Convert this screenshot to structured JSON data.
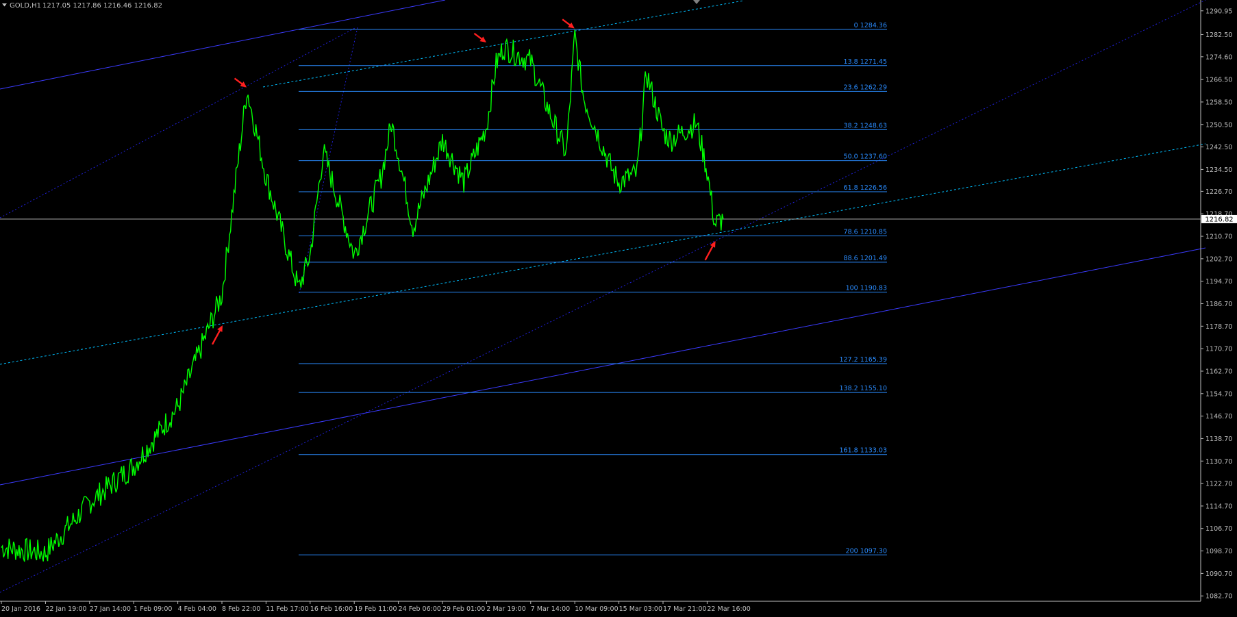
{
  "header": {
    "symbol": "GOLD,H1",
    "ohlc": "1217.05 1217.86 1216.46 1216.82",
    "menu_icon": "triangle-down-icon"
  },
  "colors": {
    "background": "#000000",
    "price": "#00ff00",
    "fib": "#2a8cff",
    "channel": "#3b3bff",
    "dashed": "#00bfff",
    "arrow": "#ff1f1f",
    "axis": "#c0c0c0"
  },
  "chart_data": {
    "type": "line",
    "title": "",
    "xlabel": "",
    "ylabel": "",
    "ylim": [
      1080.8,
      1294.8
    ],
    "grid": false,
    "current_price": "1216.82",
    "y_ticks": [
      "1290.95",
      "1282.50",
      "1274.60",
      "1266.50",
      "1258.50",
      "1250.50",
      "1242.50",
      "1234.50",
      "1226.70",
      "1218.70",
      "1210.70",
      "1202.70",
      "1194.70",
      "1186.70",
      "1178.70",
      "1170.70",
      "1162.70",
      "1154.70",
      "1146.70",
      "1138.70",
      "1130.70",
      "1122.70",
      "1114.70",
      "1106.70",
      "1098.70",
      "1090.70",
      "1082.70"
    ],
    "x_ticks": [
      "20 Jan 2016",
      "22 Jan 19:00",
      "27 Jan 14:00",
      "1 Feb 09:00",
      "4 Feb 04:00",
      "8 Feb 22:00",
      "11 Feb 17:00",
      "16 Feb 16:00",
      "19 Feb 11:00",
      "24 Feb 06:00",
      "29 Feb 01:00",
      "2 Mar 19:00",
      "7 Mar 14:00",
      "10 Mar 09:00",
      "15 Mar 03:00",
      "17 Mar 21:00",
      "22 Mar 16:00"
    ],
    "fib_levels": [
      {
        "label": "0 1284.36",
        "price": 1284.36
      },
      {
        "label": "13.8 1271.45",
        "price": 1271.45
      },
      {
        "label": "23.6 1262.29",
        "price": 1262.29
      },
      {
        "label": "38.2 1248.63",
        "price": 1248.63
      },
      {
        "label": "50.0 1237.60",
        "price": 1237.6
      },
      {
        "label": "61.8 1226.56",
        "price": 1226.56
      },
      {
        "label": "78.6 1210.85",
        "price": 1210.85
      },
      {
        "label": "88.6 1201.49",
        "price": 1201.49
      },
      {
        "label": "100 1190.83",
        "price": 1190.83
      },
      {
        "label": "127.2 1165.39",
        "price": 1165.39
      },
      {
        "label": "138.2 1155.10",
        "price": 1155.1
      },
      {
        "label": "161.8 1133.03",
        "price": 1133.03
      },
      {
        "label": "200 1097.30",
        "price": 1097.3
      }
    ],
    "price_series": [
      {
        "x": "20 Jan 2016",
        "y": 1100
      },
      {
        "x": "22 Jan 19:00",
        "y": 1098
      },
      {
        "x": "27 Jan 14:00",
        "y": 1116
      },
      {
        "x": "1 Feb 09:00",
        "y": 1129
      },
      {
        "x": "4 Feb 04:00",
        "y": 1150
      },
      {
        "x": "8 Feb 22:00",
        "y": 1190
      },
      {
        "x": "10 Feb 12:00",
        "y": 1263
      },
      {
        "x": "11 Feb 17:00",
        "y": 1232
      },
      {
        "x": "15 Feb 09:00",
        "y": 1192
      },
      {
        "x": "16 Feb 16:00",
        "y": 1204
      },
      {
        "x": "17 Feb 12:00",
        "y": 1241
      },
      {
        "x": "19 Feb 11:00",
        "y": 1204
      },
      {
        "x": "22 Feb 09:00",
        "y": 1232
      },
      {
        "x": "23 Feb 12:00",
        "y": 1251
      },
      {
        "x": "24 Feb 06:00",
        "y": 1240
      },
      {
        "x": "25 Feb 20:00",
        "y": 1214
      },
      {
        "x": "29 Feb 01:00",
        "y": 1245
      },
      {
        "x": "1 Mar 09:00",
        "y": 1230
      },
      {
        "x": "2 Mar 19:00",
        "y": 1250
      },
      {
        "x": "3 Mar 20:00",
        "y": 1272
      },
      {
        "x": "4 Mar 15:00",
        "y": 1278
      },
      {
        "x": "7 Mar 14:00",
        "y": 1273
      },
      {
        "x": "8 Mar 15:00",
        "y": 1257
      },
      {
        "x": "9 Mar 20:00",
        "y": 1240
      },
      {
        "x": "10 Mar 09:00",
        "y": 1282
      },
      {
        "x": "11 Mar 08:00",
        "y": 1260
      },
      {
        "x": "14 Mar 10:00",
        "y": 1234
      },
      {
        "x": "15 Mar 03:00",
        "y": 1230
      },
      {
        "x": "16 Mar 06:00",
        "y": 1233
      },
      {
        "x": "16 Mar 20:00",
        "y": 1269
      },
      {
        "x": "17 Mar 21:00",
        "y": 1248
      },
      {
        "x": "18 Mar 17:00",
        "y": 1245
      },
      {
        "x": "21 Mar 12:00",
        "y": 1251
      },
      {
        "x": "22 Mar 16:00",
        "y": 1234
      },
      {
        "x": "23 Mar 12:00",
        "y": 1215
      },
      {
        "x": "24 Mar 10:00",
        "y": 1216.82
      }
    ],
    "arrows": [
      {
        "direction": "up",
        "x": "8 Feb 22:00",
        "y": 1181
      },
      {
        "direction": "down",
        "x": "10 Feb 12:00",
        "y": 1263
      },
      {
        "direction": "down",
        "x": "2 Mar 19:00",
        "y": 1279
      },
      {
        "direction": "down",
        "x": "10 Mar 09:00",
        "y": 1284
      },
      {
        "direction": "up",
        "x": "23 Mar 12:00",
        "y": 1211
      }
    ]
  }
}
